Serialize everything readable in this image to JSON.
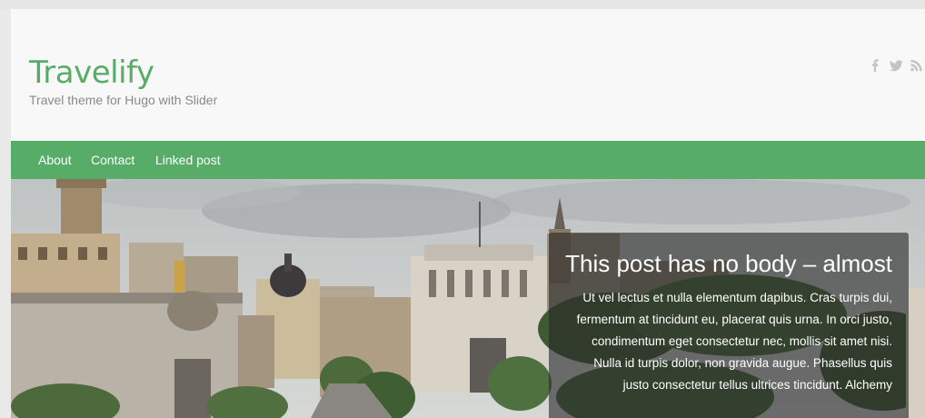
{
  "site": {
    "title": "Travelify",
    "description": "Travel theme for Hugo with Slider"
  },
  "social": {
    "icons": [
      "facebook-icon",
      "twitter-icon",
      "rss-icon"
    ],
    "color": "#c4c4c4"
  },
  "nav": {
    "items": [
      {
        "label": "About"
      },
      {
        "label": "Contact"
      },
      {
        "label": "Linked post"
      }
    ],
    "color": "#57ad68"
  },
  "slider": {
    "title": "This post has no body – almost",
    "text": "Ut vel lectus et nulla elementum dapibus. Cras turpis dui, fermentum at tincidunt eu, placerat quis urna. In orci justo, condimentum eget consectetur nec, mollis sit amet nisi. Nulla id turpis dolor, non gravida augue. Phasellus quis justo consectetur tellus ultrices tincidunt. Alchemy"
  }
}
